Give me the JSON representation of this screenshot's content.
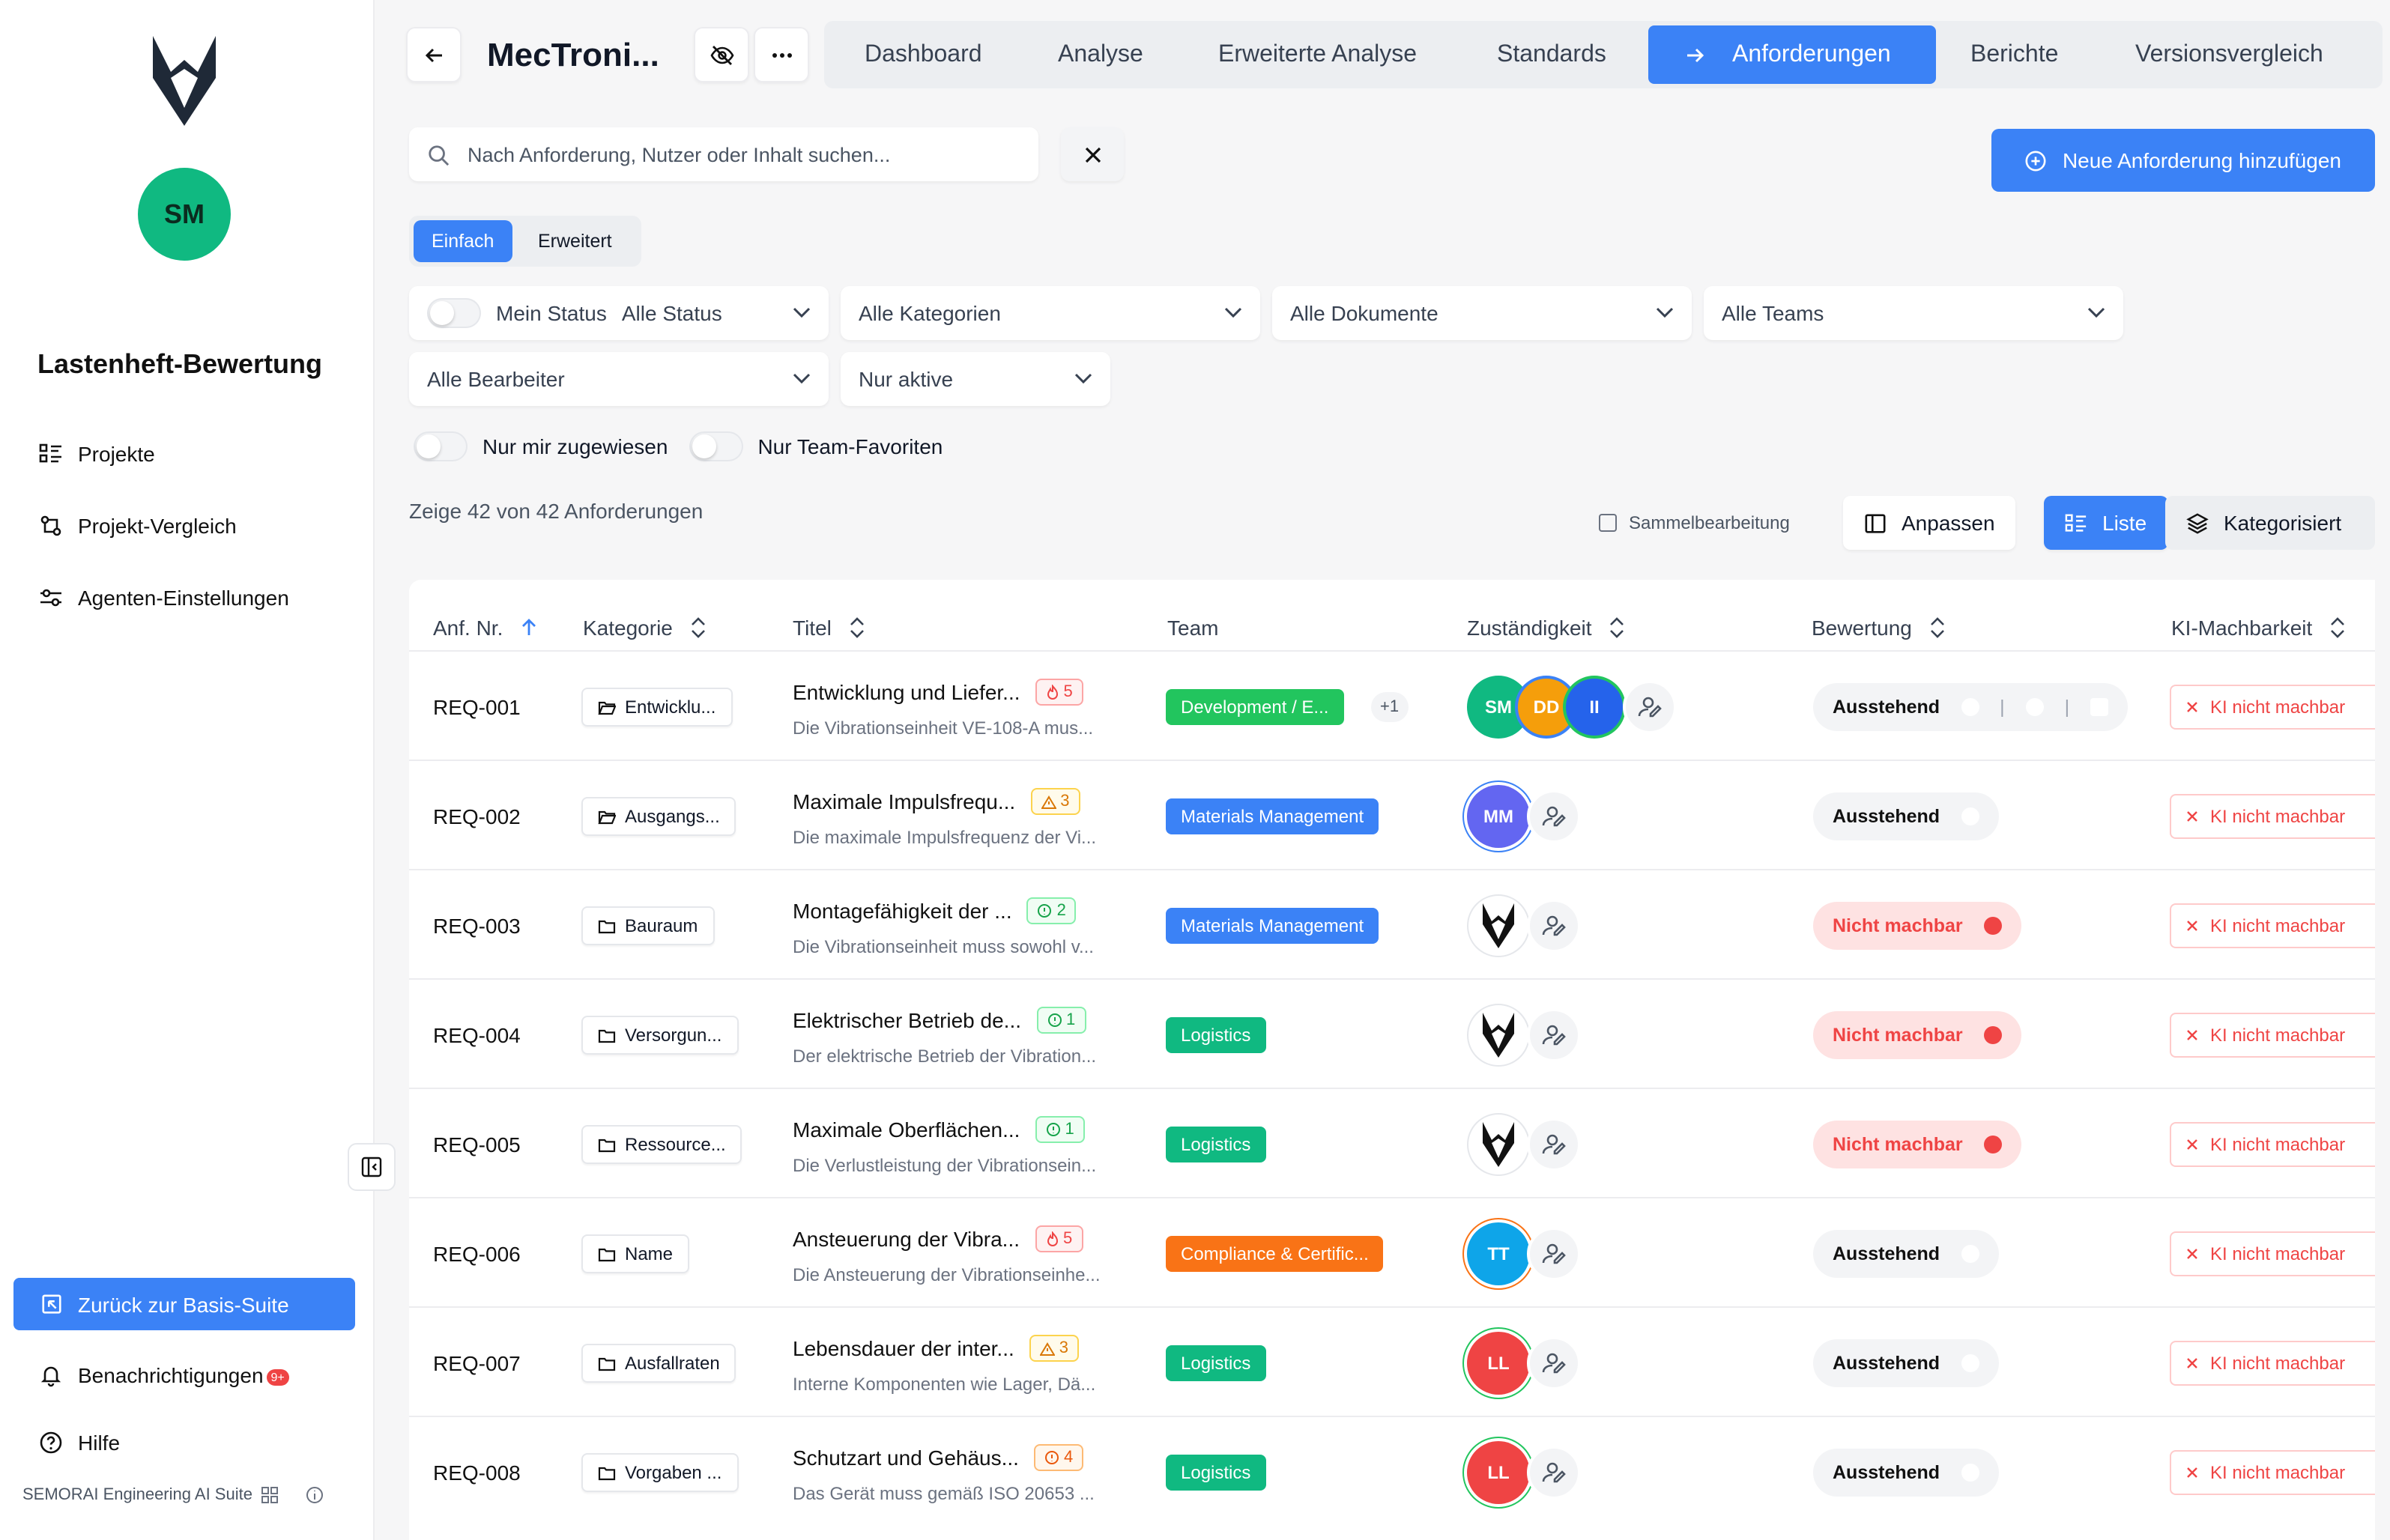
{
  "app": {
    "title": "Lastenheft-Bewertung",
    "user_initials": "SM",
    "brand": "SEMORAI Engineering AI Suite"
  },
  "sidebar": {
    "items": [
      {
        "label": "Projekte",
        "icon": "list-icon"
      },
      {
        "label": "Projekt-Vergleich",
        "icon": "compare-icon"
      },
      {
        "label": "Agenten-Einstellungen",
        "icon": "sliders-icon"
      }
    ],
    "back_label": "Zurück zur Basis-Suite",
    "notifications_label": "Benachrichtigungen",
    "notifications_badge": "9+",
    "help_label": "Hilfe"
  },
  "header": {
    "project_title": "MecTroni...",
    "tabs": [
      "Dashboard",
      "Analyse",
      "Erweiterte Analyse",
      "Standards",
      "Anforderungen",
      "Berichte",
      "Versionsvergleich"
    ],
    "active_tab": "Anforderungen"
  },
  "search": {
    "placeholder": "Nach Anforderung, Nutzer oder Inhalt suchen..."
  },
  "new_button": "Neue Anforderung hinzufügen",
  "modes": [
    "Einfach",
    "Erweitert"
  ],
  "filters": {
    "my_status": "Mein Status",
    "status": "Alle Status",
    "categories": "Alle Kategorien",
    "documents": "Alle Dokumente",
    "teams": "Alle Teams",
    "editors": "Alle Bearbeiter",
    "active": "Nur aktive",
    "assigned": "Nur mir zugewiesen",
    "favorites": "Nur Team-Favoriten"
  },
  "info": "Zeige 42 von 42 Anforderungen",
  "toolbar": {
    "bulk": "Sammelbearbeitung",
    "customize": "Anpassen",
    "list": "Liste",
    "categorized": "Kategorisiert"
  },
  "columns": [
    "Anf. Nr.",
    "Kategorie",
    "Titel",
    "Team",
    "Zuständigkeit",
    "Bewertung",
    "KI-Machbarkeit"
  ],
  "ki_label": "KI nicht machbar",
  "rows": [
    {
      "id": "REQ-001",
      "category": "Entwicklu...",
      "title": "Entwicklung und Liefer...",
      "subtitle": "Die Vibrationseinheit VE-108-A mus...",
      "prio": "5",
      "team": "Development / E...",
      "team_color": "#22c55e",
      "extra": "+1",
      "avatars": [
        "SM",
        "DD",
        "II"
      ],
      "rating": "Ausstehend"
    },
    {
      "id": "REQ-002",
      "category": "Ausgangs...",
      "title": "Maximale Impulsfrequ...",
      "subtitle": "Die maximale Impulsfrequenz der Vi...",
      "prio": "3",
      "team": "Materials Management",
      "team_color": "#3b82f6",
      "avatars": [
        "MM"
      ],
      "rating": "Ausstehend"
    },
    {
      "id": "REQ-003",
      "category": "Bauraum",
      "title": "Montagefähigkeit der ...",
      "subtitle": "Die Vibrationseinheit muss sowohl v...",
      "prio": "2",
      "team": "Materials Management",
      "team_color": "#3b82f6",
      "avatars": [
        "logo"
      ],
      "rating": "Nicht machbar"
    },
    {
      "id": "REQ-004",
      "category": "Versorgun...",
      "title": "Elektrischer Betrieb de...",
      "subtitle": "Der elektrische Betrieb der Vibration...",
      "prio": "1",
      "team": "Logistics",
      "team_color": "#10b981",
      "avatars": [
        "logo"
      ],
      "rating": "Nicht machbar"
    },
    {
      "id": "REQ-005",
      "category": "Ressource...",
      "title": "Maximale Oberflächen...",
      "subtitle": "Die Verlustleistung der Vibrationsein...",
      "prio": "1",
      "team": "Logistics",
      "team_color": "#10b981",
      "avatars": [
        "logo"
      ],
      "rating": "Nicht machbar"
    },
    {
      "id": "REQ-006",
      "category": "Name",
      "title": "Ansteuerung der Vibra...",
      "subtitle": "Die Ansteuerung der Vibrationseinhe...",
      "prio": "5",
      "team": "Compliance & Certific...",
      "team_color": "#f97316",
      "avatars": [
        "TT"
      ],
      "rating": "Ausstehend"
    },
    {
      "id": "REQ-007",
      "category": "Ausfallraten",
      "title": "Lebensdauer der inter...",
      "subtitle": "Interne Komponenten wie Lager, Dä...",
      "prio": "3",
      "team": "Logistics",
      "team_color": "#10b981",
      "avatars": [
        "LL"
      ],
      "rating": "Ausstehend"
    },
    {
      "id": "REQ-008",
      "category": "Vorgaben ...",
      "title": "Schutzart und Gehäus...",
      "subtitle": "Das Gerät muss gemäß ISO 20653 ...",
      "prio": "4",
      "team": "Logistics",
      "team_color": "#10b981",
      "avatars": [
        "LL"
      ],
      "rating": "Ausstehend"
    }
  ]
}
